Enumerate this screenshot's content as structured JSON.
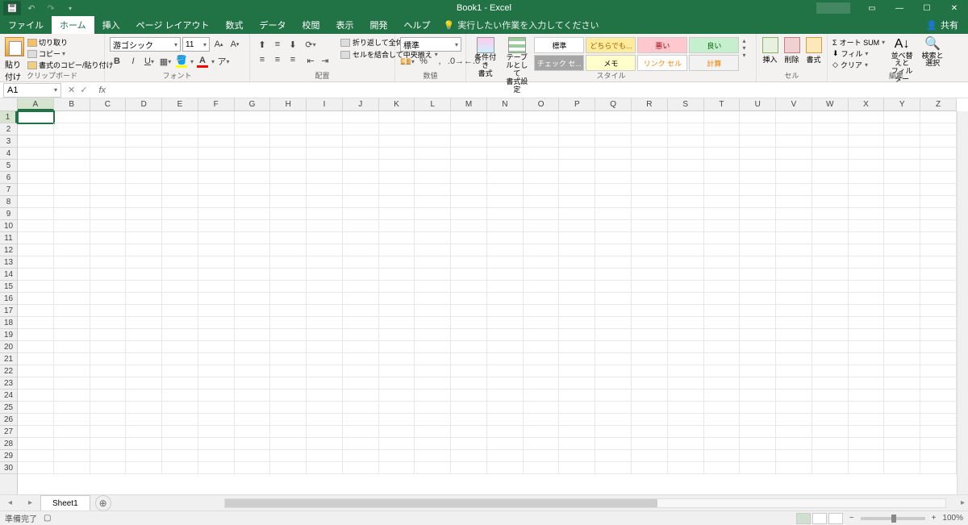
{
  "title": {
    "doc": "Book1",
    "app": "Excel"
  },
  "window": {
    "ribbon_opts": "⋯"
  },
  "menubar": {
    "file": "ファイル",
    "tabs": [
      "ホーム",
      "挿入",
      "ページ レイアウト",
      "数式",
      "データ",
      "校閲",
      "表示",
      "開発",
      "ヘルプ"
    ],
    "tellme": "実行したい作業を入力してください",
    "share": "共有"
  },
  "ribbon": {
    "clipboard": {
      "label": "クリップボード",
      "paste": "貼り付け",
      "cut": "切り取り",
      "copy": "コピー",
      "format_painter": "書式のコピー/貼り付け"
    },
    "font": {
      "label": "フォント",
      "name": "游ゴシック",
      "size": "11"
    },
    "alignment": {
      "label": "配置",
      "wrap": "折り返して全体を表示する",
      "merge": "セルを結合して中央揃え"
    },
    "number": {
      "label": "数値",
      "format": "標準"
    },
    "styles": {
      "label": "スタイル",
      "conditional": "条件付き\n書式",
      "table": "テーブルとして\n書式設定",
      "gallery": [
        {
          "text": "標準",
          "bg": "#ffffff",
          "color": "#000"
        },
        {
          "text": "どちらでも...",
          "bg": "#ffeb9c",
          "color": "#9c6500"
        },
        {
          "text": "悪い",
          "bg": "#ffc7ce",
          "color": "#9c0006"
        },
        {
          "text": "良い",
          "bg": "#c6efce",
          "color": "#006100"
        },
        {
          "text": "チェック セ...",
          "bg": "#a5a5a5",
          "color": "#fff"
        },
        {
          "text": "メモ",
          "bg": "#ffffcc",
          "color": "#000"
        },
        {
          "text": "リンク セル",
          "bg": "#ffffff",
          "color": "#ff8001"
        },
        {
          "text": "計算",
          "bg": "#f2f2f2",
          "color": "#fa7d00"
        }
      ]
    },
    "cells": {
      "label": "セル",
      "insert": "挿入",
      "delete": "削除",
      "format": "書式"
    },
    "editing": {
      "label": "編集",
      "autosum": "オート SUM",
      "fill": "フィル",
      "clear": "クリア",
      "sort": "並べ替えと\nフィルター",
      "find": "検索と\n選択"
    }
  },
  "namebox": {
    "ref": "A1"
  },
  "columns": [
    "A",
    "B",
    "C",
    "D",
    "E",
    "F",
    "G",
    "H",
    "I",
    "J",
    "K",
    "L",
    "M",
    "N",
    "O",
    "P",
    "Q",
    "R",
    "S",
    "T",
    "U",
    "V",
    "W",
    "X",
    "Y",
    "Z"
  ],
  "rows": 30,
  "sheets": {
    "active": "Sheet1"
  },
  "status": {
    "ready": "準備完了",
    "zoom": "100%"
  }
}
